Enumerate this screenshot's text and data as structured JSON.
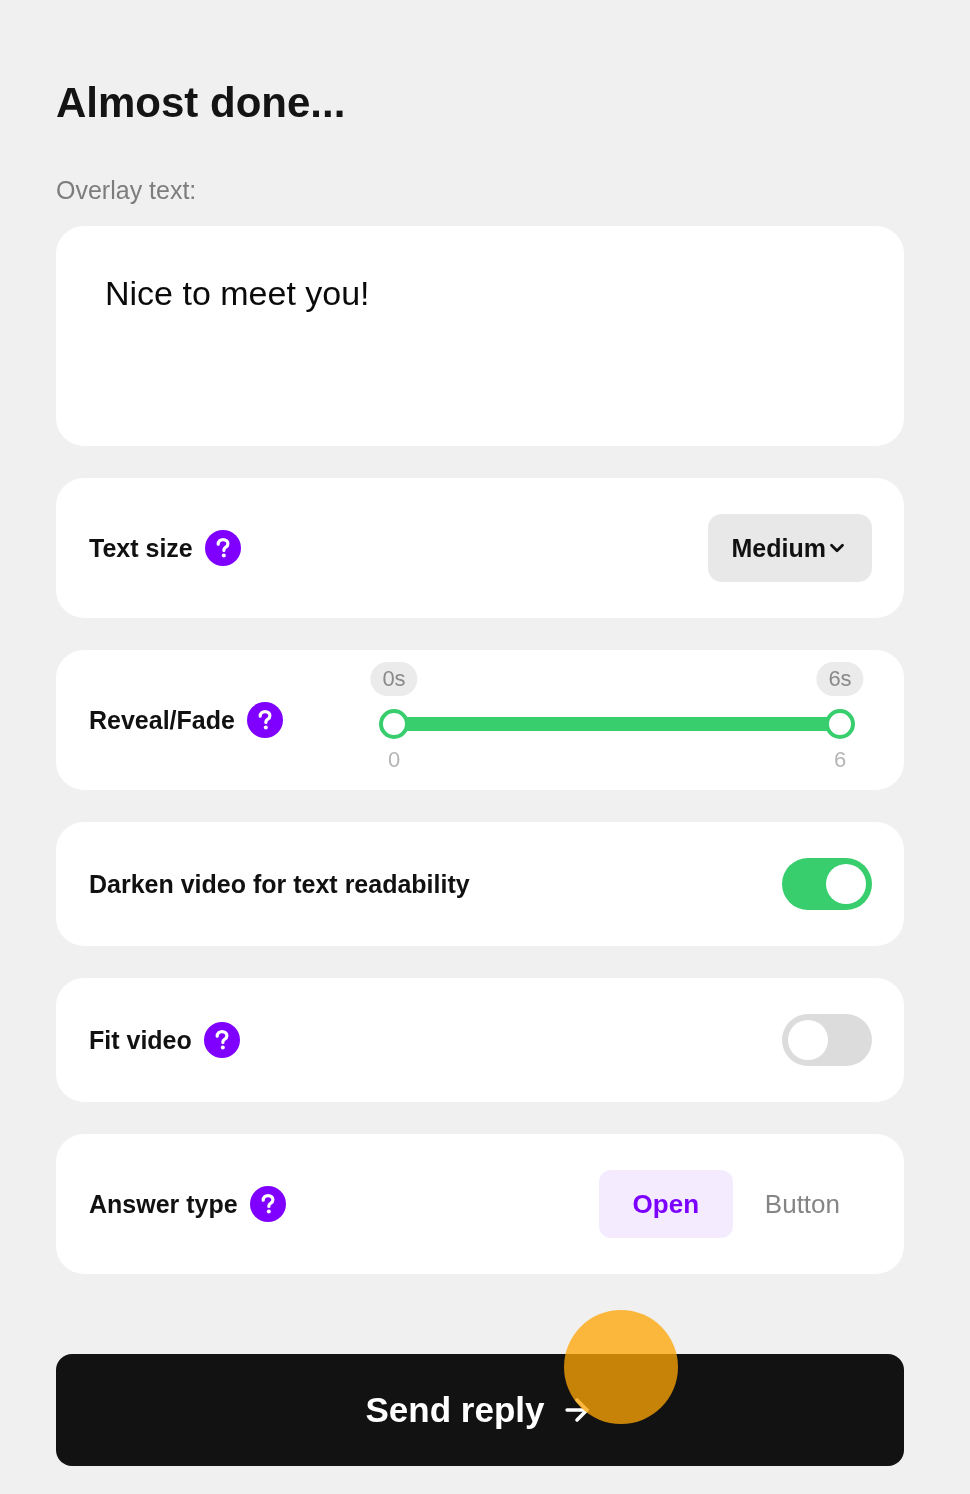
{
  "title": "Almost done...",
  "overlay": {
    "label": "Overlay text:",
    "value": "Nice to meet you!"
  },
  "settings": [
    {
      "kind": "select",
      "label": "Text size",
      "help": true,
      "value": "Medium"
    },
    {
      "kind": "range",
      "label": "Reveal/Fade",
      "help": true,
      "thumbs": [
        {
          "level": 0,
          "bubble": "0s",
          "tick": "0"
        },
        {
          "level": 1,
          "bubble": "6s",
          "tick": "6"
        }
      ]
    },
    {
      "kind": "toggle",
      "label": "Darken video for text readability",
      "help": false,
      "on": true
    },
    {
      "kind": "toggle",
      "label": "Fit video",
      "help": true,
      "on": false
    },
    {
      "kind": "segmented",
      "label": "Answer type",
      "help": true,
      "options": [
        {
          "label": "Open",
          "selected": true
        },
        {
          "label": "Button",
          "selected": false
        }
      ]
    }
  ],
  "submit": {
    "label": "Send reply"
  }
}
